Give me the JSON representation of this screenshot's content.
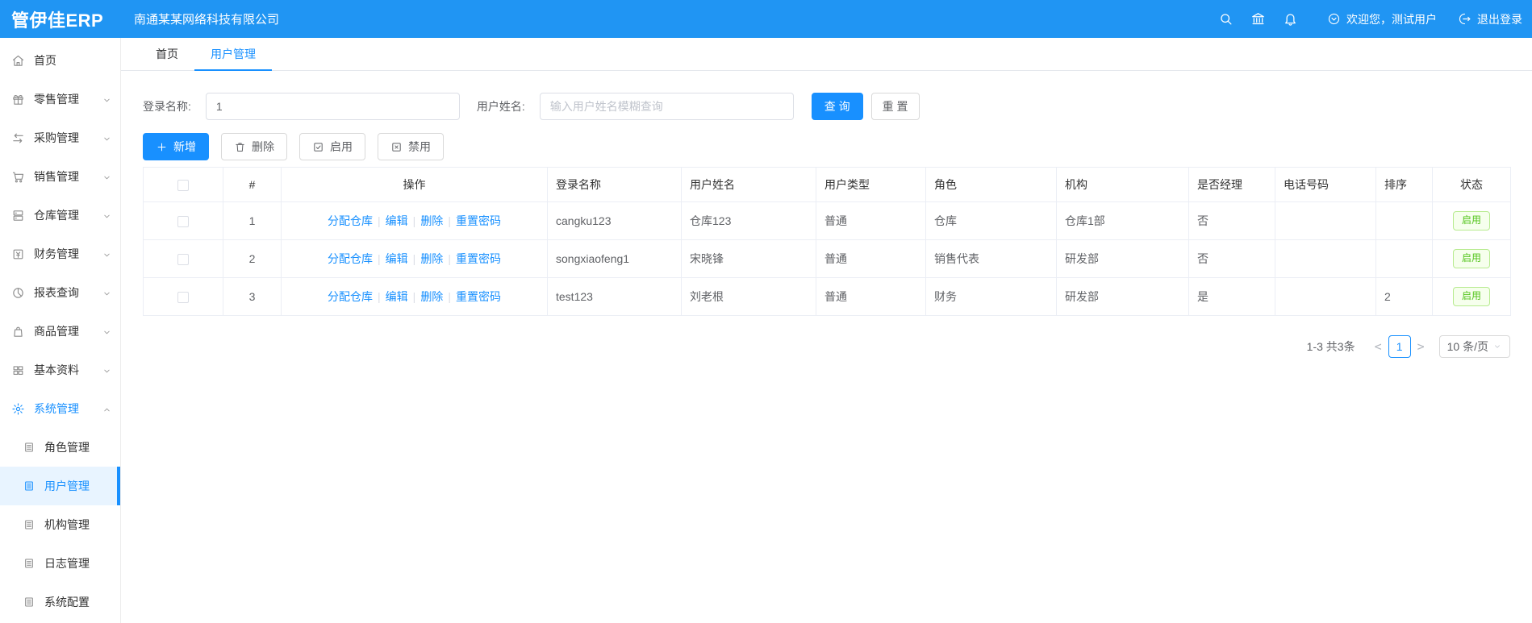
{
  "header": {
    "logo": "管伊佳ERP",
    "company": "南通某某网络科技有限公司",
    "welcome": "欢迎您，测试用户",
    "logout": "退出登录"
  },
  "sidebar": {
    "items": [
      {
        "label": "首页"
      },
      {
        "label": "零售管理"
      },
      {
        "label": "采购管理"
      },
      {
        "label": "销售管理"
      },
      {
        "label": "仓库管理"
      },
      {
        "label": "财务管理"
      },
      {
        "label": "报表查询"
      },
      {
        "label": "商品管理"
      },
      {
        "label": "基本资料"
      },
      {
        "label": "系统管理"
      }
    ],
    "sub_items": [
      {
        "label": "角色管理"
      },
      {
        "label": "用户管理"
      },
      {
        "label": "机构管理"
      },
      {
        "label": "日志管理"
      },
      {
        "label": "系统配置"
      }
    ]
  },
  "tabs": [
    {
      "label": "首页"
    },
    {
      "label": "用户管理"
    }
  ],
  "search": {
    "login_label": "登录名称:",
    "login_value": "1",
    "name_label": "用户姓名:",
    "name_placeholder": "输入用户姓名模糊查询",
    "query_label": "查 询",
    "reset_label": "重 置"
  },
  "toolbar": {
    "add_label": "新增",
    "delete_label": "删除",
    "enable_label": "启用",
    "disable_label": "禁用"
  },
  "table": {
    "headers": [
      "#",
      "操作",
      "登录名称",
      "用户姓名",
      "用户类型",
      "角色",
      "机构",
      "是否经理",
      "电话号码",
      "排序",
      "状态"
    ],
    "action_links": [
      "分配仓库",
      "编辑",
      "删除",
      "重置密码"
    ],
    "rows": [
      {
        "index": "1",
        "login": "cangku123",
        "name": "仓库123",
        "type": "普通",
        "role": "仓库",
        "org": "仓库1部",
        "manager": "否",
        "phone": "",
        "sort": "",
        "status": "启用"
      },
      {
        "index": "2",
        "login": "songxiaofeng1",
        "name": "宋晓锋",
        "type": "普通",
        "role": "销售代表",
        "org": "研发部",
        "manager": "否",
        "phone": "",
        "sort": "",
        "status": "启用"
      },
      {
        "index": "3",
        "login": "test123",
        "name": "刘老根",
        "type": "普通",
        "role": "财务",
        "org": "研发部",
        "manager": "是",
        "phone": "",
        "sort": "2",
        "status": "启用"
      }
    ]
  },
  "pagination": {
    "total_text": "1-3 共3条",
    "prev": "<",
    "current_page": "1",
    "next": ">",
    "page_size": "10 条/页"
  },
  "colors": {
    "header_bg": "#2095f3",
    "primary": "#1890ff",
    "success": "#52c41a"
  }
}
